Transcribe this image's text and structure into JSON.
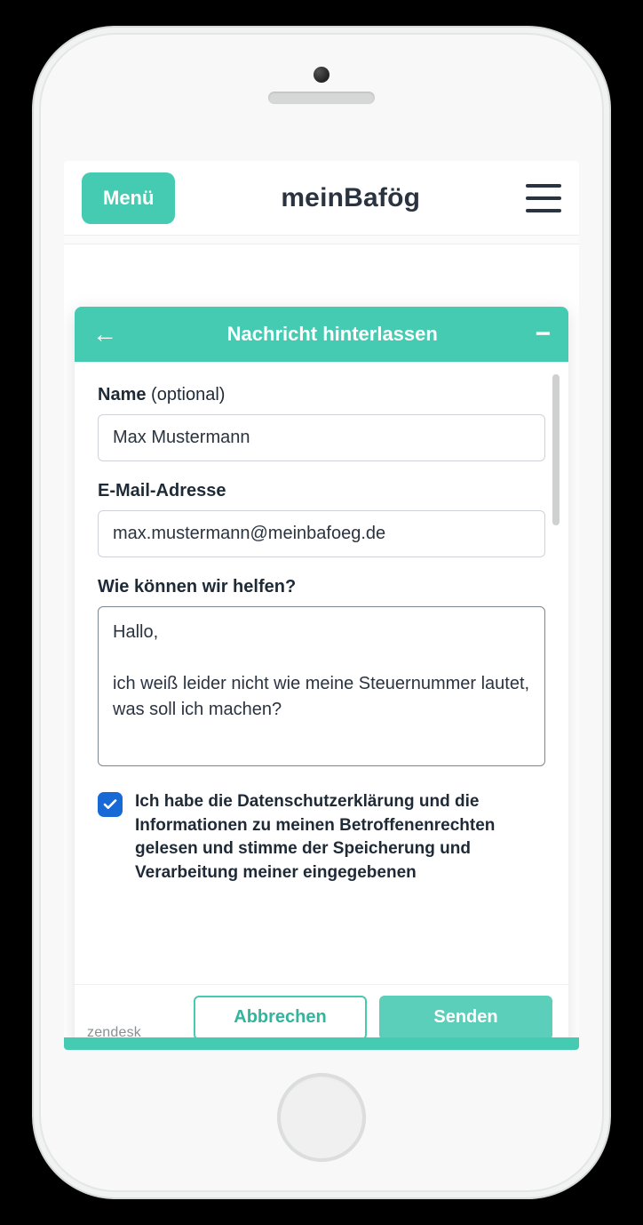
{
  "header": {
    "menu_label": "Menü",
    "brand_plain": "mein",
    "brand_bold": "Bafög"
  },
  "widget": {
    "title": "Nachricht hinterlassen",
    "fields": {
      "name_label": "Name",
      "name_optional": "(optional)",
      "name_value": "Max Mustermann",
      "email_label": "E-Mail-Adresse",
      "email_value": "max.mustermann@meinbafoeg.de",
      "message_label": "Wie können wir helfen?",
      "message_value": "Hallo,\n\nich weiß leider nicht wie meine Steuernummer lautet, was soll ich machen?"
    },
    "consent_checked": true,
    "consent_text": "Ich habe die Datenschutzerklärung und die Informationen zu meinen Betroffenenrechten gelesen und stimme der Speicherung und Verarbeitung meiner eingegebenen",
    "cancel_label": "Abbrechen",
    "submit_label": "Senden",
    "branding": "zendesk"
  }
}
